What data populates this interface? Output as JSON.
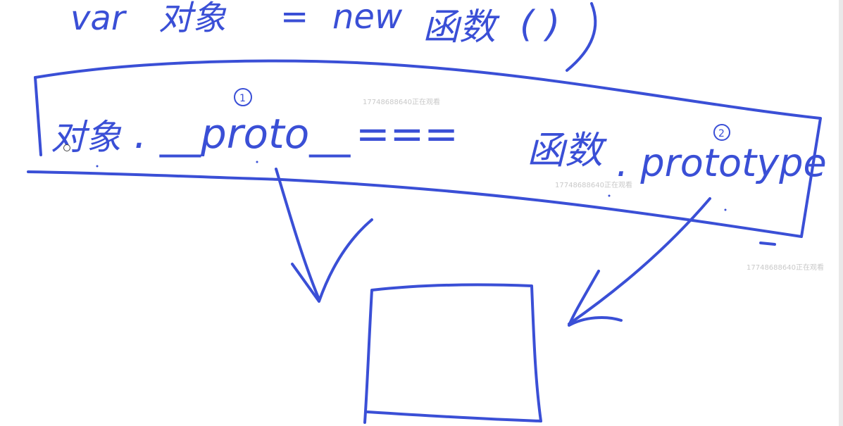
{
  "top_line": {
    "var": "var",
    "obj": "对象",
    "eq": "=",
    "new": "new",
    "fn": "函数",
    "paren": "( )"
  },
  "boxed_line": {
    "obj": "对象",
    "dot_proto": ". __proto__",
    "equals": "===",
    "fn": "函数",
    "dot_prototype": ". prototype",
    "marker_1": "1",
    "marker_2": "2"
  },
  "watermarks": [
    "17748688640正在观看",
    "17748688640正在观看",
    "17748688640正在观看"
  ],
  "ink_color": "#3a4fd6"
}
